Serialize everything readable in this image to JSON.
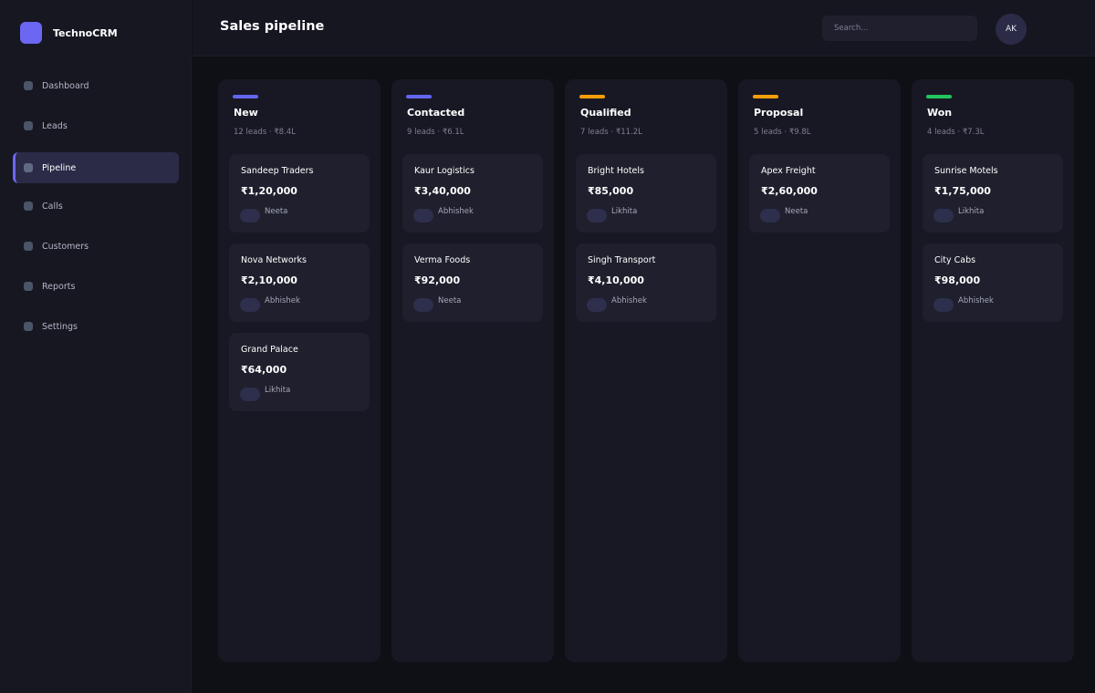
{
  "app": {
    "name": "TechnoCRM"
  },
  "sidebar": {
    "items": [
      {
        "label": "Dashboard",
        "icon": "dashboard-icon"
      },
      {
        "label": "Leads",
        "icon": "leads-icon"
      },
      {
        "label": "Pipeline",
        "icon": "pipeline-icon",
        "active": true
      },
      {
        "label": "Calls",
        "icon": "calls-icon"
      },
      {
        "label": "Customers",
        "icon": "customers-icon"
      },
      {
        "label": "Reports",
        "icon": "reports-icon"
      },
      {
        "label": "Settings",
        "icon": "settings-icon"
      }
    ]
  },
  "header": {
    "title": "Sales pipeline",
    "search_placeholder": "Search...",
    "user_initials": "AK"
  },
  "colors": {
    "accent": "#6b67f2",
    "indigo": "#6366f1",
    "amber": "#f59e0b",
    "green": "#22c55e"
  },
  "columns": [
    {
      "title": "New",
      "meta": "12 leads · ₹8.4L",
      "color": "#6366f1",
      "cards": [
        {
          "name": "Sandeep Traders",
          "amount": "₹1,20,000",
          "owner": "Neeta"
        },
        {
          "name": "Nova Networks",
          "amount": "₹2,10,000",
          "owner": "Abhishek"
        },
        {
          "name": "Grand Palace",
          "amount": "₹64,000",
          "owner": "Likhita"
        }
      ]
    },
    {
      "title": "Contacted",
      "meta": "9 leads · ₹6.1L",
      "color": "#6366f1",
      "cards": [
        {
          "name": "Kaur Logistics",
          "amount": "₹3,40,000",
          "owner": "Abhishek"
        },
        {
          "name": "Verma Foods",
          "amount": "₹92,000",
          "owner": "Neeta"
        }
      ]
    },
    {
      "title": "Qualified",
      "meta": "7 leads · ₹11.2L",
      "color": "#f59e0b",
      "cards": [
        {
          "name": "Bright Hotels",
          "amount": "₹85,000",
          "owner": "Likhita"
        },
        {
          "name": "Singh Transport",
          "amount": "₹4,10,000",
          "owner": "Abhishek"
        }
      ]
    },
    {
      "title": "Proposal",
      "meta": "5 leads · ₹9.8L",
      "color": "#f59e0b",
      "cards": [
        {
          "name": "Apex Freight",
          "amount": "₹2,60,000",
          "owner": "Neeta"
        }
      ]
    },
    {
      "title": "Won",
      "meta": "4 leads · ₹7.3L",
      "color": "#22c55e",
      "cards": [
        {
          "name": "Sunrise Motels",
          "amount": "₹1,75,000",
          "owner": "Likhita"
        },
        {
          "name": "City Cabs",
          "amount": "₹98,000",
          "owner": "Abhishek"
        }
      ]
    }
  ]
}
